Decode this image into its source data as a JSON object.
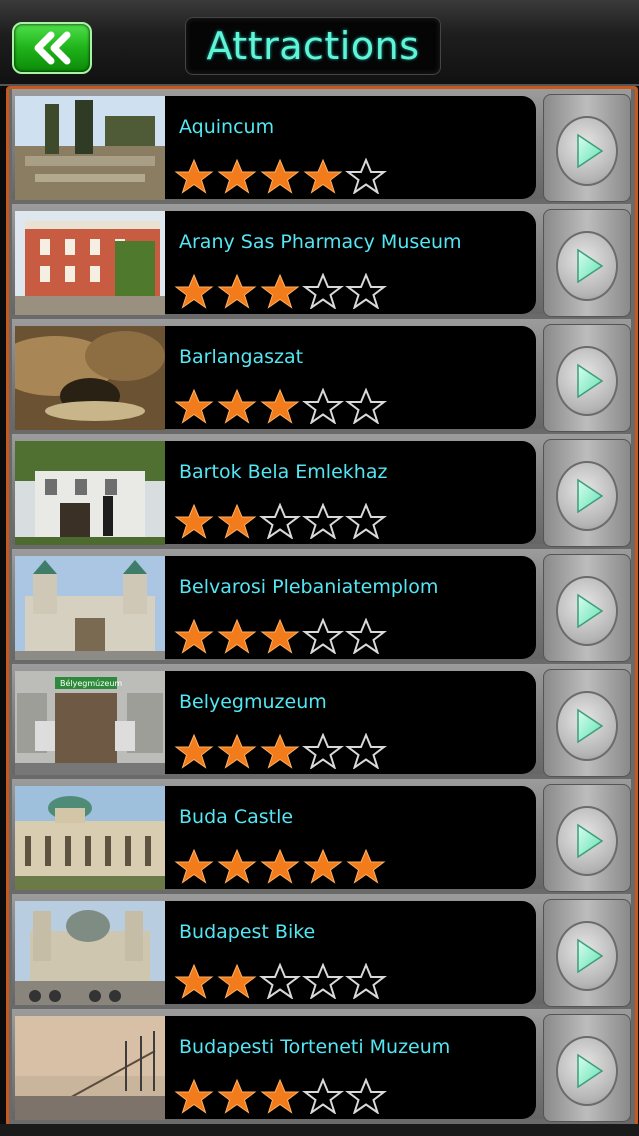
{
  "header": {
    "title": "Attractions",
    "back_icon": "double-chevron-left-icon"
  },
  "colors": {
    "accent_text": "#53e6f3",
    "title_text": "#5ff5d5",
    "star_filled": "#f27c1c",
    "border_orange": "#c8591c",
    "back_button_green": "#1fb31a"
  },
  "attractions": [
    {
      "name": "Aquincum",
      "rating": 4
    },
    {
      "name": "Arany Sas Pharmacy Museum",
      "rating": 3
    },
    {
      "name": "Barlangaszat",
      "rating": 3
    },
    {
      "name": "Bartok Bela Emlekhaz",
      "rating": 2
    },
    {
      "name": "Belvarosi Plebaniatemplom",
      "rating": 3
    },
    {
      "name": "Belyegmuzeum",
      "rating": 3,
      "photo_sign": "Bélyegmúzeum"
    },
    {
      "name": "Buda Castle",
      "rating": 5
    },
    {
      "name": "Budapest Bike",
      "rating": 2
    },
    {
      "name": "Budapesti Torteneti Muzeum",
      "rating": 3
    }
  ],
  "max_rating": 5
}
